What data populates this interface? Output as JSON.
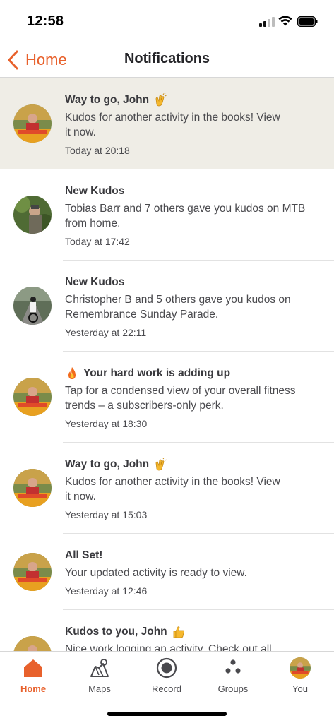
{
  "status_bar": {
    "time": "12:58"
  },
  "header": {
    "back_label": "Home",
    "title": "Notifications"
  },
  "notifications": [
    {
      "title": "Way to go, John",
      "emoji": "clapping-hands-icon",
      "body_line1": "Kudos for another activity in the books! View",
      "body_line2": "it now.",
      "time": "Today at 20:18",
      "avatar": "avatar-kayak",
      "unread": true
    },
    {
      "title": "New Kudos",
      "emoji": "",
      "body_line1": "Tobias Barr  and 7 others gave you kudos on MTB",
      "body_line2": "from home.",
      "time": "Today at 17:42",
      "avatar": "avatar-forest",
      "unread": false
    },
    {
      "title": "New Kudos",
      "emoji": "",
      "body_line1": "Christopher B and 5 others gave you kudos on",
      "body_line2": "Remembrance Sunday Parade.",
      "time": "Yesterday at 22:11",
      "avatar": "avatar-cyclist",
      "unread": false
    },
    {
      "title": "Your hard work is adding up",
      "emoji": "fire-icon",
      "body_line1": "Tap for a condensed view of your overall fitness",
      "body_line2": "trends – a subscribers-only perk.",
      "time": "Yesterday at 18:30",
      "avatar": "avatar-kayak",
      "unread": false
    },
    {
      "title": "Way to go, John",
      "emoji": "clapping-hands-icon",
      "body_line1": "Kudos for another activity in the books! View",
      "body_line2": "it now.",
      "time": "Yesterday at 15:03",
      "avatar": "avatar-kayak",
      "unread": false
    },
    {
      "title": "All Set!",
      "emoji": "",
      "body_line1": "Your updated activity is ready to view.",
      "body_line2": "",
      "time": "Yesterday at 12:46",
      "avatar": "avatar-kayak",
      "unread": false
    },
    {
      "title": "Kudos to you, John",
      "emoji": "thumbs-up-icon",
      "body_line1": "Nice work logging an activity. Check out all",
      "body_line2": "",
      "time": "",
      "avatar": "avatar-kayak",
      "unread": false
    }
  ],
  "tab_bar": {
    "home": "Home",
    "maps": "Maps",
    "record": "Record",
    "groups": "Groups",
    "you": "You",
    "active": "home"
  },
  "colors": {
    "accent": "#e8612c",
    "unread_bg": "#efede6",
    "text": "#242428"
  }
}
